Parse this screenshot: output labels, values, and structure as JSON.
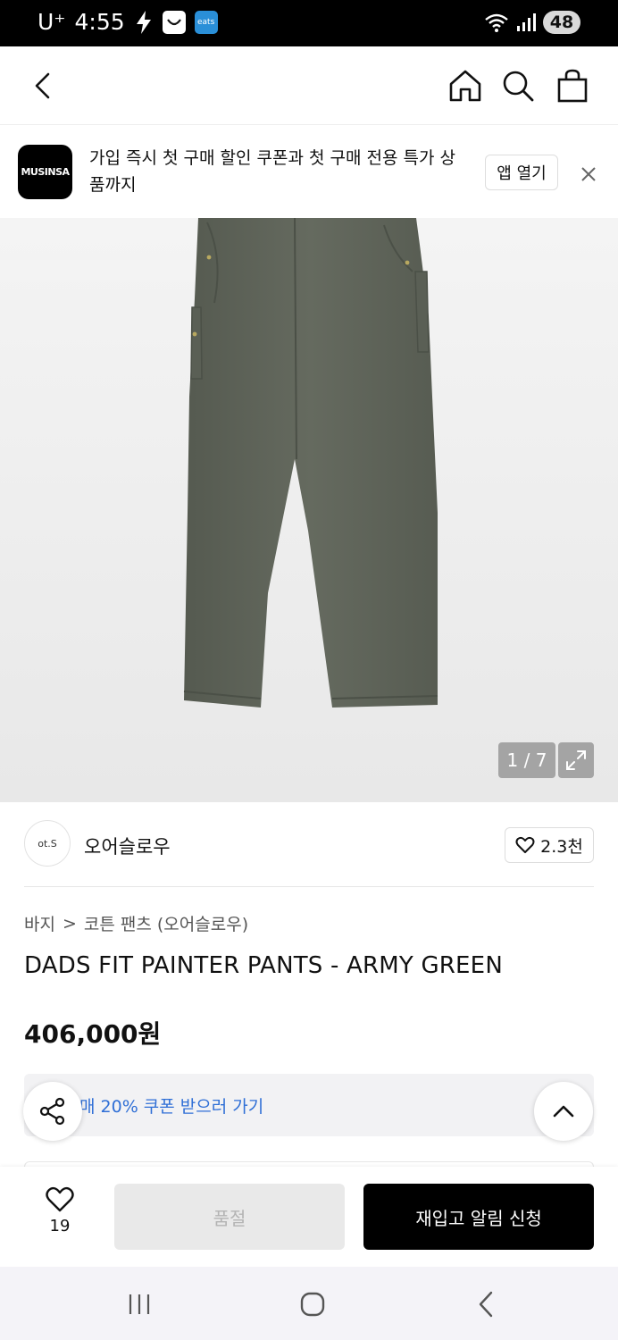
{
  "status_bar": {
    "carrier": "U⁺",
    "time": "4:55",
    "eats_badge": "eats",
    "battery": "48",
    "icons": [
      "bolt-icon",
      "app-badge-icon",
      "eats-badge-icon",
      "wifi-icon",
      "signal-icon",
      "battery-icon"
    ]
  },
  "nav": {
    "icons": [
      "back-icon",
      "home-icon",
      "search-icon",
      "bag-icon"
    ]
  },
  "banner": {
    "logo_text": "MUSINSA",
    "message": "가입 즉시 첫 구매 할인 쿠폰과 첫 구매 전용 특가 상품까지",
    "open_app": "앱 열기"
  },
  "gallery": {
    "counter": "1 / 7"
  },
  "brand": {
    "logo_text": "ot.S",
    "name": "오어슬로우",
    "likes": "2.3천"
  },
  "breadcrumb": {
    "category": "바지",
    "separator": ">",
    "subcategory": "코튼 팬츠 (오어슬로우)"
  },
  "product": {
    "title": "DADS FIT PAINTER PANTS - ARMY GREEN",
    "price": "406,000원"
  },
  "coupon": {
    "text": "매 20% 쿠폰 받으러 가기"
  },
  "bottom_bar": {
    "wish_count": "19",
    "soldout_label": "품절",
    "restock_label": "재입고 알림 신청"
  },
  "colors": {
    "accent_blue": "#2f6fd6",
    "product_green": "#5e6358",
    "primary_black": "#000000"
  }
}
